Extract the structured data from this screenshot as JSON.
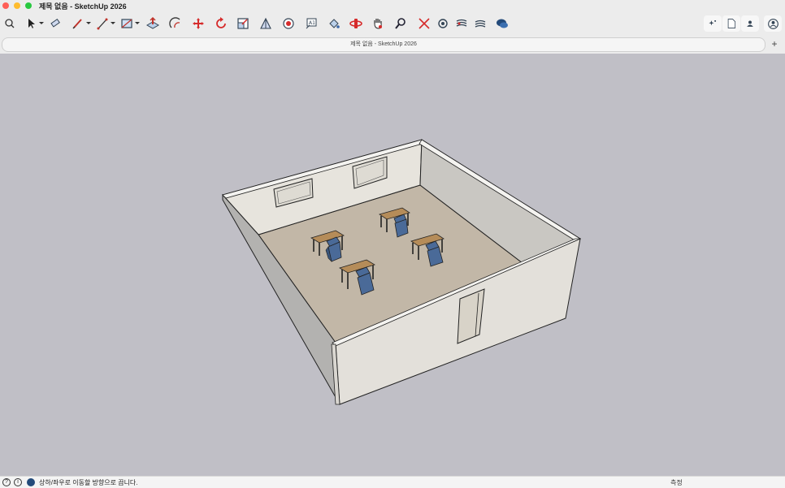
{
  "window": {
    "title": "제목 없음 - SketchUp 2026"
  },
  "tab": {
    "label": "제목 없음 - SketchUp 2026",
    "add_label": "+"
  },
  "status": {
    "hint": "상하/좌우로 이동할 방향으로 끕니다.",
    "measurement_label": "측정"
  },
  "toolbar": {
    "tools": [
      "search",
      "select",
      "eraser",
      "pencil",
      "line",
      "rectangle",
      "push-pull",
      "offset",
      "move",
      "rotate",
      "scale",
      "follow-me",
      "tape-measure",
      "text",
      "paint-bucket",
      "orbit",
      "pan",
      "zoom",
      "zoom-extents",
      "section-plane",
      "scene",
      "styles",
      "chat"
    ],
    "right_tools": [
      "ai-assistant",
      "new-file",
      "collaborators",
      "account"
    ]
  },
  "scene": {
    "desks": 4,
    "chairs": 4,
    "windows": 2,
    "doors": 1
  },
  "colors": {
    "viewport_bg": "#c0bfc6",
    "floor": "#c2b7a7",
    "wall_light": "#e7e4dd",
    "wall_shade": "#c9c7c2",
    "chair": "#4a6a98",
    "desk": "#b58c59"
  }
}
